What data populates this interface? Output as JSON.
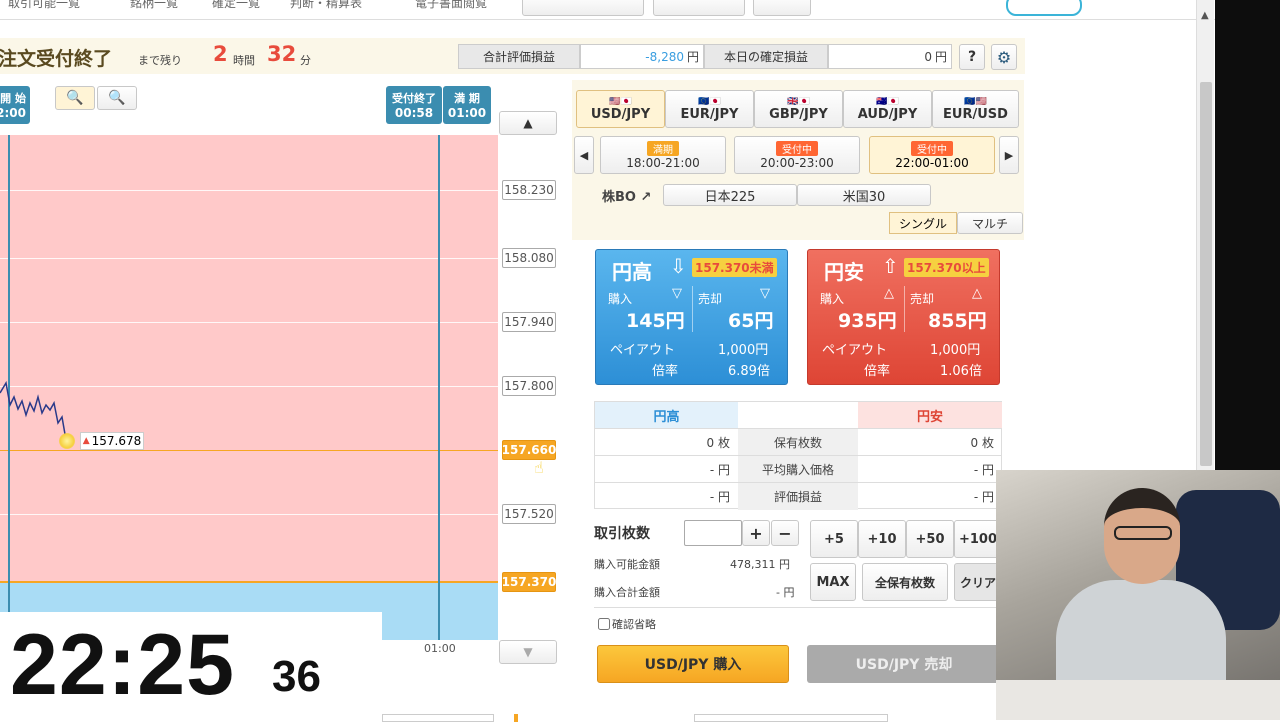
{
  "nav": {
    "items": [
      "取引可能一覧",
      "銘柄一覧",
      "確定一覧",
      "判断・精算表",
      "電子書面閲覧"
    ]
  },
  "header": {
    "title": "注文受付終了",
    "remain_label": "まで残り",
    "hours": "2",
    "hours_unit": "時間",
    "minutes": "32",
    "minutes_unit": "分",
    "eval_label": "合計評価損益",
    "eval_value": "-8,280",
    "eval_unit": "円",
    "today_label": "本日の確定損益",
    "today_value": "0",
    "today_unit": "円",
    "help": "?"
  },
  "chart": {
    "start_label": "開 始",
    "start_time": "2:00",
    "end_label": "受付終了",
    "end_time": "00:58",
    "expiry_label": "満 期",
    "expiry_time": "01:00",
    "current_price": "157.678",
    "x_tick": "01:00",
    "prices": [
      "158.230",
      "158.080",
      "157.940",
      "157.800",
      "157.660",
      "157.520",
      "157.370"
    ]
  },
  "clock": {
    "hm": "22:25",
    "sec": "36"
  },
  "pairs": [
    {
      "label": "USD/JPY"
    },
    {
      "label": "EUR/JPY"
    },
    {
      "label": "GBP/JPY"
    },
    {
      "label": "AUD/JPY"
    },
    {
      "label": "EUR/USD"
    }
  ],
  "sessions": [
    {
      "status": "満期",
      "time": "18:00-21:00"
    },
    {
      "status": "受付中",
      "time": "20:00-23:00"
    },
    {
      "status": "受付中",
      "time": "22:00-01:00"
    }
  ],
  "stock": {
    "label": "株BO",
    "items": [
      "日本225",
      "米国30"
    ]
  },
  "mode": {
    "single": "シングル",
    "multi": "マルチ"
  },
  "high": {
    "title": "円高",
    "threshold": "157.370未満",
    "buy_label": "購入",
    "sell_label": "売却",
    "buy": "145円",
    "sell": "65円",
    "payout_label": "ペイアウト",
    "payout": "1,000円",
    "ratio_label": "倍率",
    "ratio": "6.89倍"
  },
  "low": {
    "title": "円安",
    "threshold": "157.370以上",
    "buy_label": "購入",
    "sell_label": "売却",
    "buy": "935円",
    "sell": "855円",
    "payout_label": "ペイアウト",
    "payout": "1,000円",
    "ratio_label": "倍率",
    "ratio": "1.06倍"
  },
  "holdings": {
    "col_high": "円高",
    "col_low": "円安",
    "rows": [
      {
        "label": "保有枚数",
        "high": "0 枚",
        "low": "0 枚"
      },
      {
        "label": "平均購入価格",
        "high": "- 円",
        "low": "- 円"
      },
      {
        "label": "評価損益",
        "high": "- 円",
        "low": "- 円"
      }
    ]
  },
  "order": {
    "qty_label": "取引枚数",
    "plus": "+",
    "minus": "−",
    "quick": [
      "+5",
      "+10",
      "+50",
      "+100"
    ],
    "available_label": "購入可能金額",
    "available": "478,311 円",
    "total_label": "購入合計金額",
    "total": "- 円",
    "max": "MAX",
    "all": "全保有枚数",
    "clear": "クリア",
    "confirm": "確認省略",
    "buy_btn": "USD/JPY 購入",
    "sell_btn": "USD/JPY 売却"
  },
  "colors": {
    "accent": "#f6a623",
    "high": "#3a9ee0",
    "low": "#e84b3c",
    "pink": "#ffc9c9",
    "blue": "#a9dcf5"
  }
}
